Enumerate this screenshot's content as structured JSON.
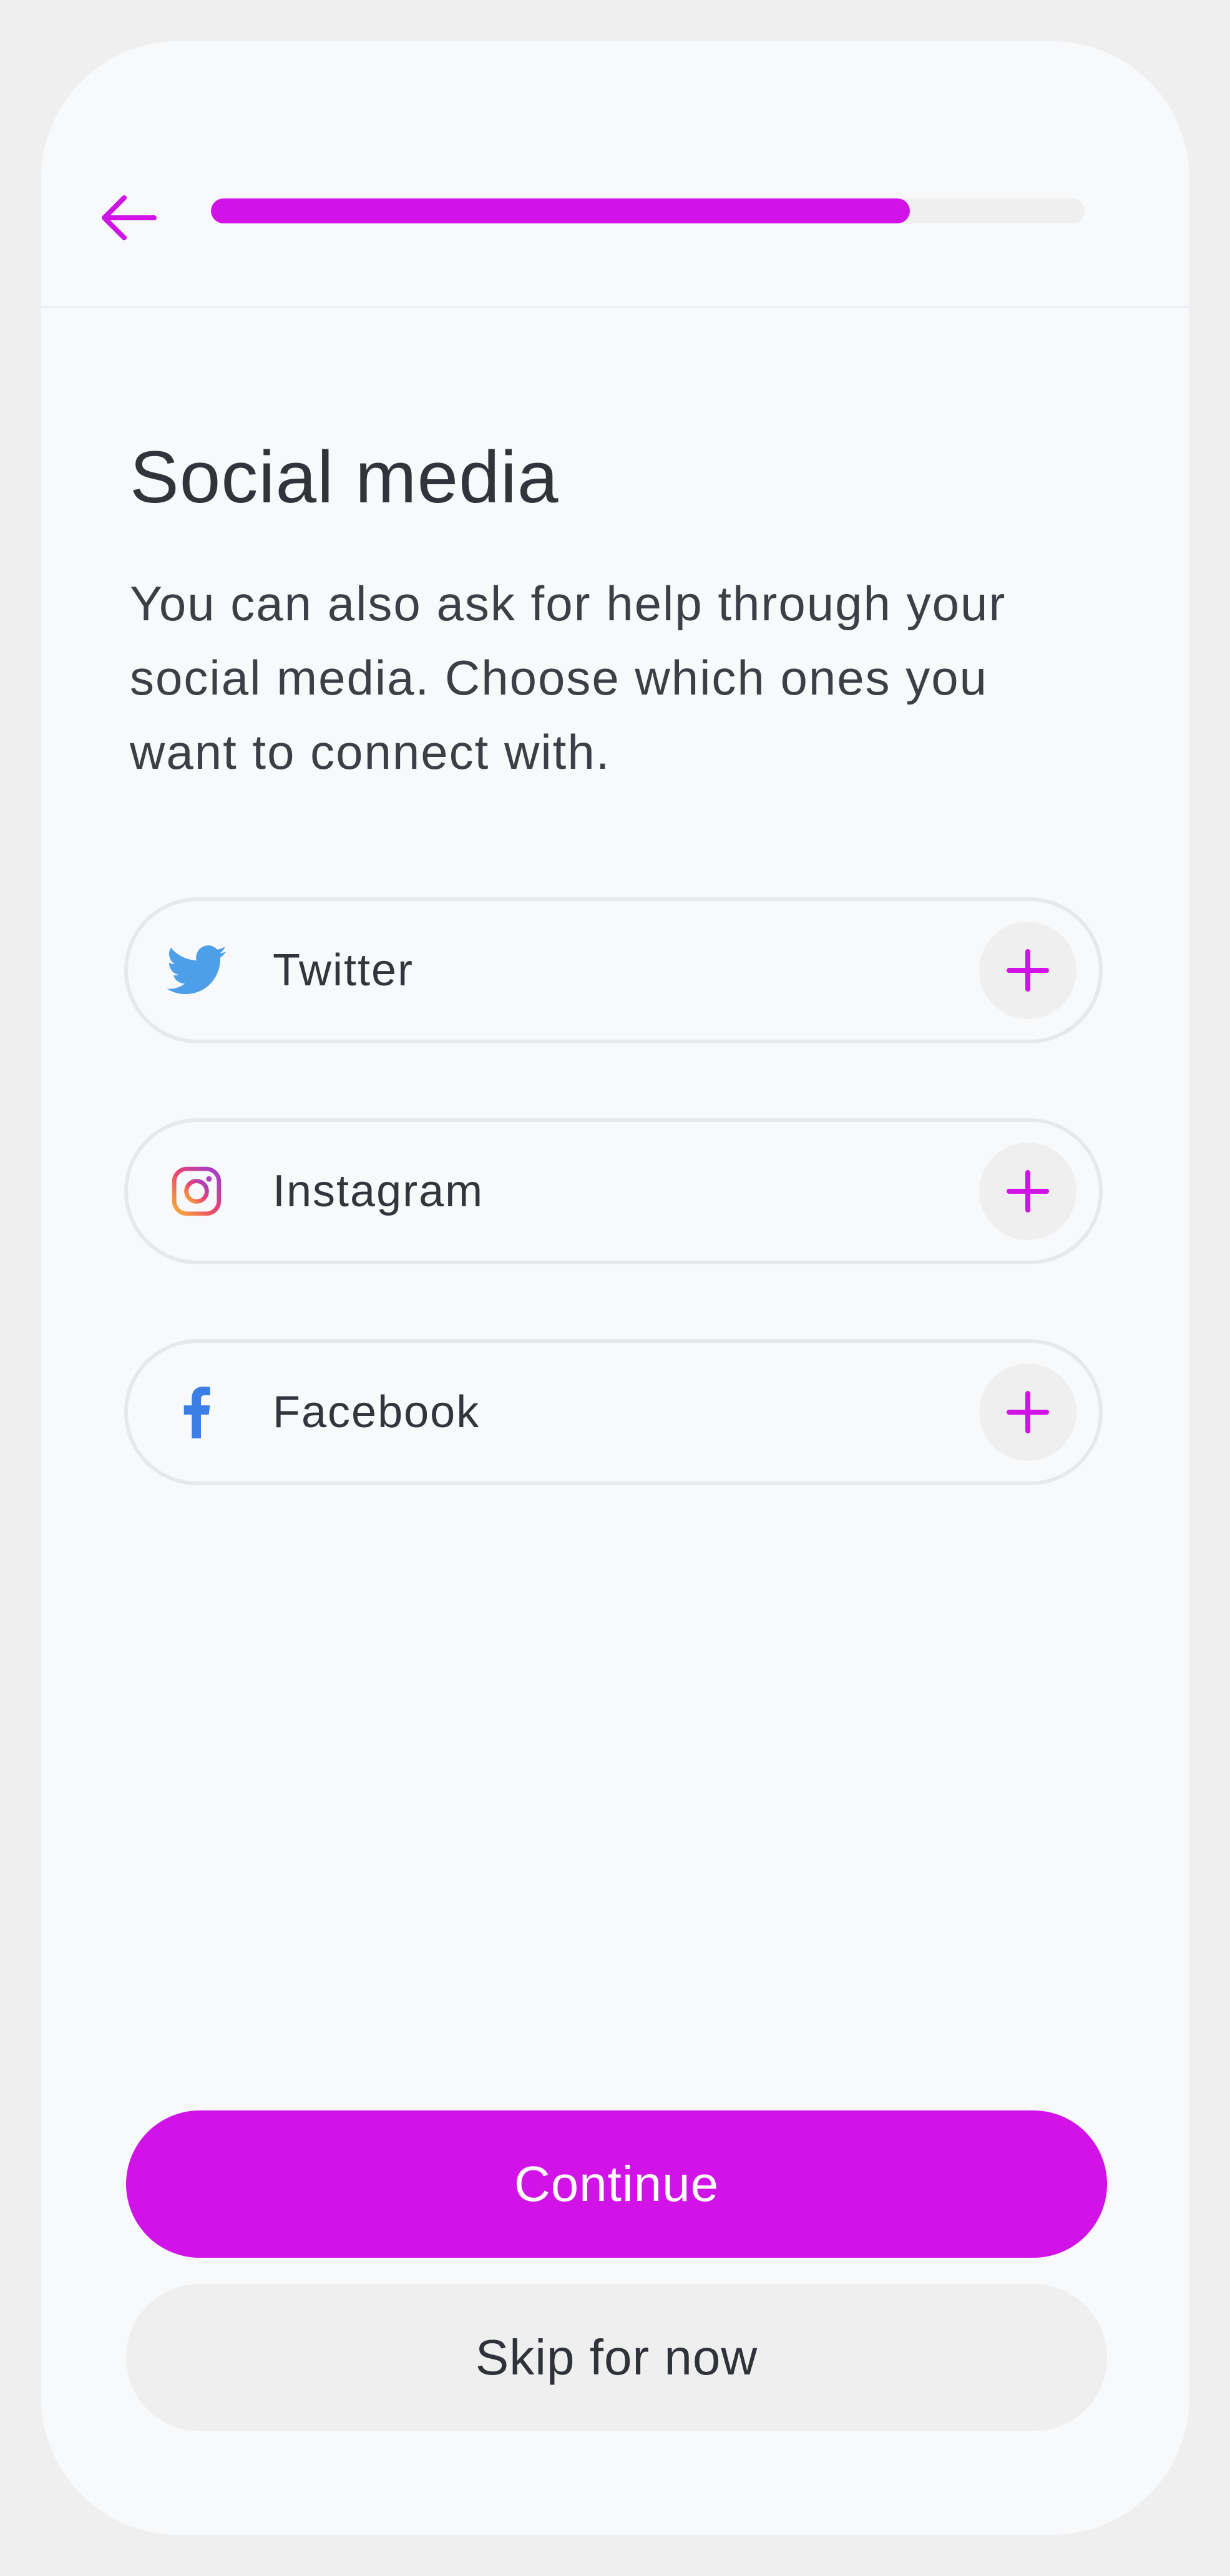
{
  "header": {
    "progress": 0.8,
    "accent_color": "#d113e8",
    "back_icon": "arrow-left-icon"
  },
  "main": {
    "title": "Social media",
    "description": "You can also ask for help through your social media. Choose which ones you want to connect with."
  },
  "social_accounts": [
    {
      "label": "Twitter",
      "icon": "twitter-icon",
      "action_icon": "plus-icon"
    },
    {
      "label": "Instagram",
      "icon": "instagram-icon",
      "action_icon": "plus-icon"
    },
    {
      "label": "Facebook",
      "icon": "facebook-icon",
      "action_icon": "plus-icon"
    }
  ],
  "actions": {
    "continue_label": "Continue",
    "skip_label": "Skip for now"
  },
  "colors": {
    "accent": "#d113e8",
    "twitter": "#4c9fe8",
    "facebook": "#3b7fe6"
  }
}
